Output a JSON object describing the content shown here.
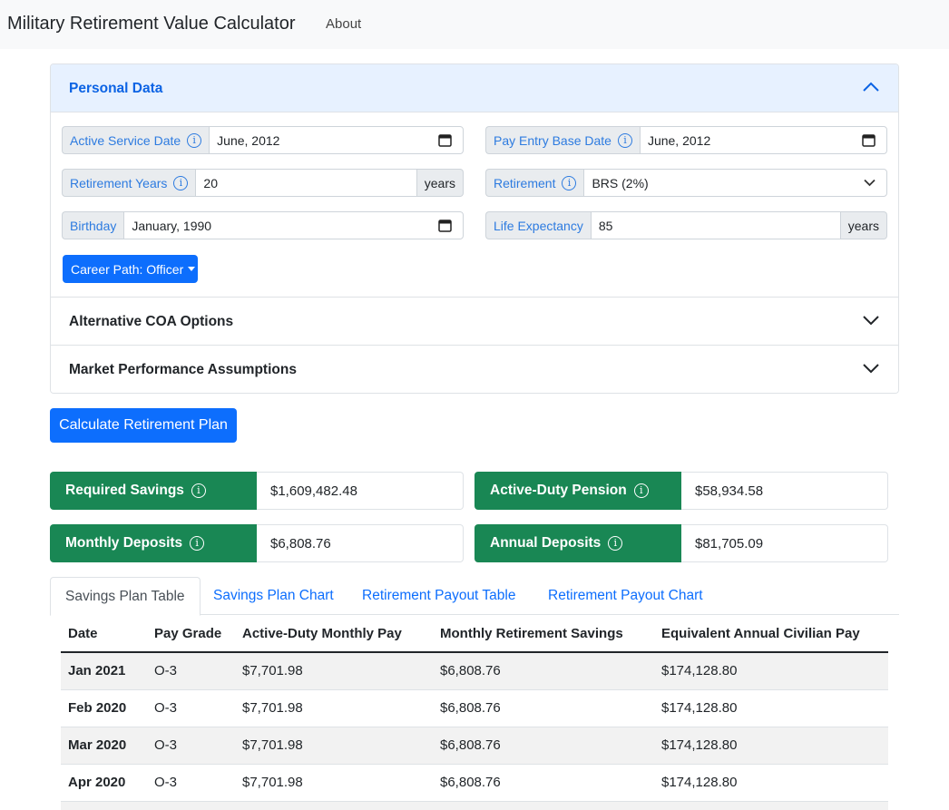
{
  "navbar": {
    "brand": "Military Retirement Value Calculator",
    "about": "About"
  },
  "personal": {
    "title": "Personal Data",
    "active_service": {
      "label": "Active Service Date",
      "value": "June, 2012"
    },
    "pay_entry": {
      "label": "Pay Entry Base Date",
      "value": "June, 2012"
    },
    "retirement_years": {
      "label": "Retirement Years",
      "value": "20",
      "suffix": "years"
    },
    "retirement": {
      "label": "Retirement",
      "value": "BRS (2%)"
    },
    "birthday": {
      "label": "Birthday",
      "value": "January, 1990"
    },
    "life_expectancy": {
      "label": "Life Expectancy",
      "value": "85",
      "suffix": "years"
    },
    "career_path": "Career Path: Officer"
  },
  "sections": {
    "alt_coa": "Alternative COA Options",
    "market": "Market Performance Assumptions"
  },
  "calculate_label": "Calculate Retirement Plan",
  "results": {
    "required_savings": {
      "label": "Required Savings",
      "value": "$1,609,482.48"
    },
    "pension": {
      "label": "Active-Duty Pension",
      "value": "$58,934.58"
    },
    "monthly_deposits": {
      "label": "Monthly Deposits",
      "value": "$6,808.76"
    },
    "annual_deposits": {
      "label": "Annual Deposits",
      "value": "$81,705.09"
    }
  },
  "tabs": [
    "Savings Plan Table",
    "Savings Plan Chart",
    "Retirement Payout Table",
    "Retirement Payout Chart"
  ],
  "table": {
    "headers": [
      "Date",
      "Pay Grade",
      "Active-Duty Monthly Pay",
      "Monthly Retirement Savings",
      "Equivalent Annual Civilian Pay"
    ],
    "rows": [
      [
        "Jan 2021",
        "O-3",
        "$7,701.98",
        "$6,808.76",
        "$174,128.80"
      ],
      [
        "Feb 2020",
        "O-3",
        "$7,701.98",
        "$6,808.76",
        "$174,128.80"
      ],
      [
        "Mar 2020",
        "O-3",
        "$7,701.98",
        "$6,808.76",
        "$174,128.80"
      ],
      [
        "Apr 2020",
        "O-3",
        "$7,701.98",
        "$6,808.76",
        "$174,128.80"
      ],
      [
        "",
        "",
        "",
        "",
        ""
      ]
    ]
  },
  "icons": {
    "info": "info-circle-icon",
    "calendar": "calendar-icon",
    "chevron_up": "chevron-up-icon",
    "chevron_down": "chevron-down-icon",
    "caret": "caret-down-icon"
  },
  "colors": {
    "primary": "#0d6efd",
    "success": "#198754",
    "accordion_active": "#e7f1ff",
    "label_blue": "#2d7be0"
  }
}
